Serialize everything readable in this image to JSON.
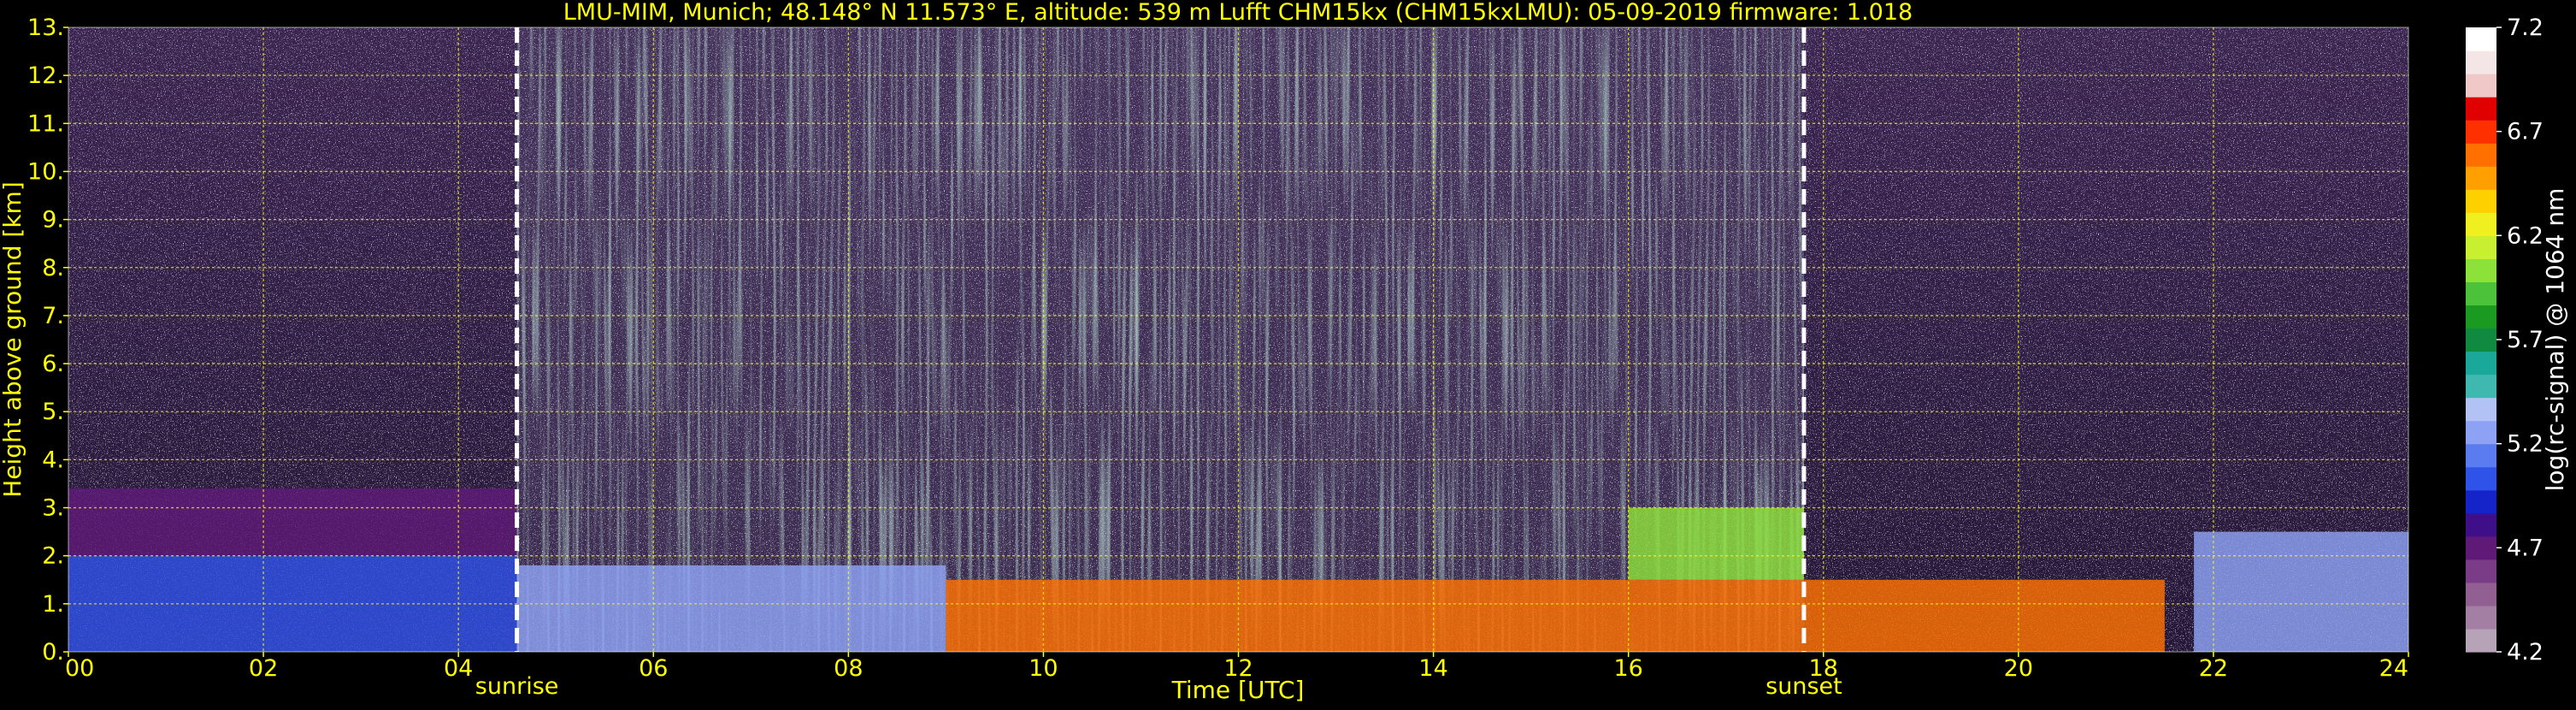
{
  "colors": {
    "background": "#000000",
    "label_text": "#ffff00",
    "colorbar_text": "#ffffff",
    "grid": "#ffff00",
    "event_line": "#ffffff"
  },
  "chart_data": {
    "type": "heatmap",
    "title": "LMU-MIM, Munich; 48.148° N 11.573° E, altitude: 539 m    Lufft CHM15kx (CHM15kxLMU): 05-09-2019    firmware: 1.018",
    "xlabel": "Time [UTC]",
    "ylabel": "Height above ground [km]",
    "xlim": [
      0,
      24
    ],
    "ylim": [
      0,
      13
    ],
    "x_ticks": [
      {
        "value": 0,
        "label": "00"
      },
      {
        "value": 2,
        "label": "02"
      },
      {
        "value": 4,
        "label": "04"
      },
      {
        "value": 6,
        "label": "06"
      },
      {
        "value": 8,
        "label": "08"
      },
      {
        "value": 10,
        "label": "10"
      },
      {
        "value": 12,
        "label": "12"
      },
      {
        "value": 14,
        "label": "14"
      },
      {
        "value": 16,
        "label": "16"
      },
      {
        "value": 18,
        "label": "18"
      },
      {
        "value": 20,
        "label": "20"
      },
      {
        "value": 22,
        "label": "22"
      },
      {
        "value": 24,
        "label": "24"
      }
    ],
    "y_ticks": [
      {
        "value": 0,
        "label": "0."
      },
      {
        "value": 1,
        "label": "1."
      },
      {
        "value": 2,
        "label": "2."
      },
      {
        "value": 3,
        "label": "3."
      },
      {
        "value": 4,
        "label": "4."
      },
      {
        "value": 5,
        "label": "5."
      },
      {
        "value": 6,
        "label": "6."
      },
      {
        "value": 7,
        "label": "7."
      },
      {
        "value": 8,
        "label": "8."
      },
      {
        "value": 9,
        "label": "9."
      },
      {
        "value": 10,
        "label": "10."
      },
      {
        "value": 11,
        "label": "11."
      },
      {
        "value": 12,
        "label": "12."
      },
      {
        "value": 13,
        "label": "13."
      }
    ],
    "grid": true,
    "events": [
      {
        "label": "sunrise",
        "time": 4.6
      },
      {
        "label": "sunset",
        "time": 17.8
      }
    ],
    "colorbar": {
      "label": "log(rc-signal) @ 1064 nm",
      "range": [
        4.2,
        7.2
      ],
      "ticks": [
        {
          "value": 4.2,
          "label": "4.2"
        },
        {
          "value": 4.7,
          "label": "4.7"
        },
        {
          "value": 5.2,
          "label": "5.2"
        },
        {
          "value": 5.7,
          "label": "5.7"
        },
        {
          "value": 6.2,
          "label": "6.2"
        },
        {
          "value": 6.7,
          "label": "6.7"
        },
        {
          "value": 7.2,
          "label": "7.2"
        }
      ],
      "colors": [
        "#b7a3b7",
        "#a47fa4",
        "#925f92",
        "#7a3c86",
        "#5f1a78",
        "#3f0f8a",
        "#1424c8",
        "#2f52e8",
        "#5a7cf0",
        "#8da2f4",
        "#b3c2f5",
        "#3fb8b0",
        "#1aa89a",
        "#0f8a40",
        "#1a9a20",
        "#4cc23a",
        "#8de23a",
        "#c8f030",
        "#f0f020",
        "#ffd000",
        "#ffa000",
        "#ff7000",
        "#ff3000",
        "#e00000",
        "#f0c8c8",
        "#f4e6e6",
        "#ffffff"
      ]
    },
    "layers": [
      {
        "x": [
          0,
          4.6
        ],
        "y": [
          0,
          2.0
        ],
        "value": 5.0
      },
      {
        "x": [
          0,
          4.6
        ],
        "y": [
          2.0,
          3.4
        ],
        "value": 4.7
      },
      {
        "x": [
          4.6,
          9.0
        ],
        "y": [
          0,
          1.8
        ],
        "value": 5.2
      },
      {
        "x": [
          9.0,
          21.5
        ],
        "y": [
          0,
          1.5
        ],
        "value": 6.6
      },
      {
        "x": [
          16.0,
          17.8
        ],
        "y": [
          1.5,
          3.0
        ],
        "value": 6.0
      },
      {
        "x": [
          21.8,
          24
        ],
        "y": [
          0,
          2.5
        ],
        "value": 5.2
      }
    ]
  }
}
